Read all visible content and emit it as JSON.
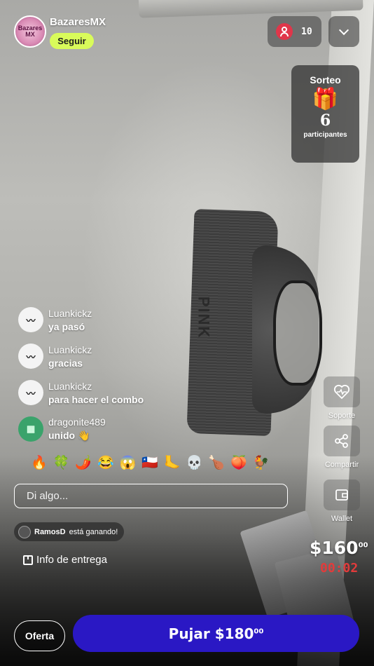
{
  "seller": {
    "name": "BazaresMX",
    "avatar_text": "Bazares MX",
    "follow_label": "Seguir"
  },
  "viewers": {
    "count": "10"
  },
  "giveaway": {
    "title": "Sorteo",
    "icon": "🎁",
    "count": "6",
    "label": "participantes"
  },
  "product": {
    "brand_text": "PINK"
  },
  "chat": {
    "messages": [
      {
        "user": "Luankickz",
        "text": "ya pasó"
      },
      {
        "user": "Luankickz",
        "text": "gracias"
      },
      {
        "user": "Luankickz",
        "text": "para hacer el combo"
      },
      {
        "user": "dragonite489",
        "text": "unido 👋"
      }
    ],
    "input_placeholder": "Di algo..."
  },
  "emojis": [
    "🔥",
    "🍀",
    "🌶️",
    "😂",
    "😱",
    "🇨🇱",
    "🦶",
    "💀",
    "🍗",
    "🍑",
    "🐓"
  ],
  "winner": {
    "user": "RamosD",
    "text": "está ganando!"
  },
  "delivery_label": "Info de entrega",
  "side_actions": {
    "support": "Soporte",
    "share": "Compartir",
    "wallet": "Wallet"
  },
  "auction": {
    "current_price": "$160",
    "current_cents": "00",
    "timer": "00:02",
    "offer_label": "Oferta",
    "bid_label": "Pujar $180",
    "bid_cents": "00"
  },
  "colors": {
    "follow": "#d9fb5a",
    "bid": "#2a18c4",
    "timer": "#e23b3b",
    "viewer_badge": "#e0364a"
  }
}
